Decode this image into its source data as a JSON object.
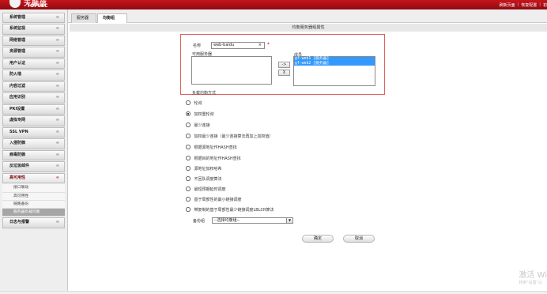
{
  "header": {
    "logo_cn": "天融信",
    "logo_en": "TOPSEC",
    "links": [
      "刷新页面",
      "恢复配置",
      "初"
    ]
  },
  "sidebar": {
    "items": [
      {
        "label": "系统管理"
      },
      {
        "label": "系统监视"
      },
      {
        "label": "网络管理"
      },
      {
        "label": "资源管理"
      },
      {
        "label": "用户认证"
      },
      {
        "label": "防火墙"
      },
      {
        "label": "内容过滤"
      },
      {
        "label": "应用识别"
      },
      {
        "label": "PKI设置"
      },
      {
        "label": "虚拟专网"
      },
      {
        "label": "SSL VPN"
      },
      {
        "label": "入侵防御"
      },
      {
        "label": "病毒防御"
      },
      {
        "label": "反垃圾邮件"
      },
      {
        "label": "高可用性"
      }
    ],
    "submenu": [
      "接口联动",
      "高可用性",
      "链路备份",
      "服务器负载均衡"
    ],
    "after": [
      {
        "label": "日志与报警"
      }
    ],
    "chevron": "≈"
  },
  "tabs": [
    {
      "label": "服务器"
    },
    {
      "label": "均衡组"
    }
  ],
  "panel": {
    "title": "均衡服务器组属性",
    "name_label": "名称",
    "name_value": "web-baidu",
    "clear_glyph": "×",
    "required_mark": "*",
    "available_label": "可用服务器",
    "members_label": "成员",
    "members": [
      "gf-web1 [服务器]",
      "gf-web2 [服务器]"
    ],
    "move_right": "->",
    "move_left": "X",
    "method_label": "负载均衡方式",
    "methods": [
      {
        "label": "轮询",
        "selected": false
      },
      {
        "label": "加权重轮询",
        "selected": true
      },
      {
        "label": "最少连接",
        "selected": false
      },
      {
        "label": "加权最少连接（最少连接算法再加上加权值）",
        "selected": false
      },
      {
        "label": "根据源地址作HASH查找",
        "selected": false
      },
      {
        "label": "根据目的地址作HASH查找",
        "selected": false
      },
      {
        "label": "源地址加权哈希",
        "selected": false
      },
      {
        "label": "不回队调度算法",
        "selected": false
      },
      {
        "label": "最短预期延时调度",
        "selected": false
      },
      {
        "label": "基于局部性的最小链接调度",
        "selected": false
      },
      {
        "label": "带复制的基于局部性最少链接调度LBLCR算法",
        "selected": false
      }
    ],
    "backup_label": "备份组",
    "backup_value": "--选择均衡组--",
    "ok": "确定",
    "cancel": "取消"
  },
  "watermark": {
    "line1": "激活 Wi",
    "line2": "转到\"设置\"以"
  }
}
